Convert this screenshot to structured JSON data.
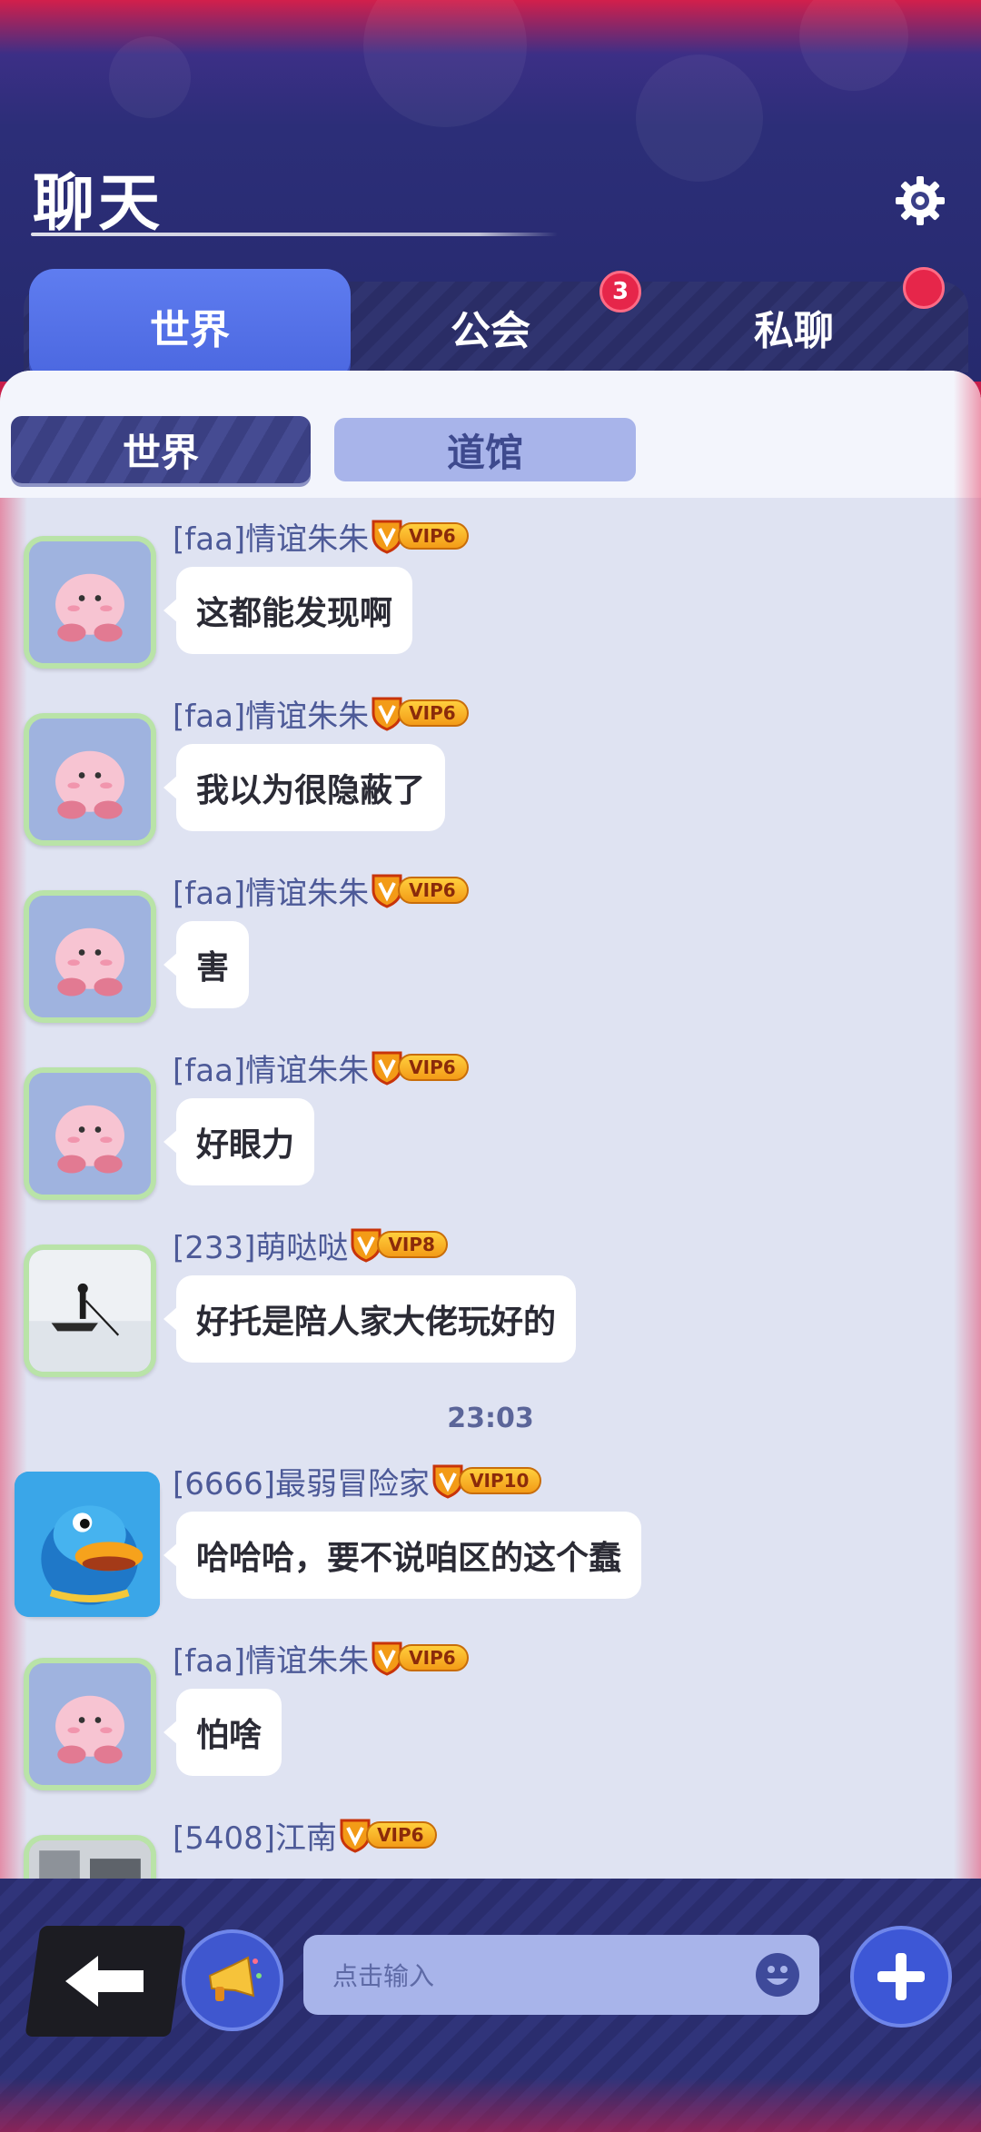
{
  "header": {
    "title": "聊天"
  },
  "tabs": [
    {
      "label": "世界",
      "active": true
    },
    {
      "label": "公会",
      "badge": "3"
    },
    {
      "label": "私聊",
      "dot": true
    }
  ],
  "subtabs": [
    {
      "label": "世界",
      "active": true
    },
    {
      "label": "道馆"
    }
  ],
  "messages": [
    {
      "sender": "[faa]情谊朱朱",
      "vip": "VIP6",
      "text": "这都能发现啊",
      "avatar": "pink-blob-avatar"
    },
    {
      "sender": "[faa]情谊朱朱",
      "vip": "VIP6",
      "text": "我以为很隐蔽了",
      "avatar": "pink-blob-avatar"
    },
    {
      "sender": "[faa]情谊朱朱",
      "vip": "VIP6",
      "text": "害",
      "avatar": "pink-blob-avatar"
    },
    {
      "sender": "[faa]情谊朱朱",
      "vip": "VIP6",
      "text": "好眼力",
      "avatar": "pink-blob-avatar"
    },
    {
      "sender": "[233]萌哒哒",
      "vip": "VIP8",
      "text": "好托是陪人家大佬玩好的",
      "avatar": "boat-avatar"
    },
    {
      "sender": "[6666]最弱冒险家",
      "vip": "VIP10",
      "text": "哈哈哈，要不说咱区的这个蠢",
      "avatar": "duck-avatar"
    },
    {
      "sender": "[faa]情谊朱朱",
      "vip": "VIP6",
      "text": "怕啥",
      "avatar": "pink-blob-avatar"
    },
    {
      "sender": "[5408]江南",
      "vip": "VIP6",
      "text": "",
      "avatar": "photo-avatar"
    }
  ],
  "timestamp": "23:03",
  "input": {
    "placeholder": "点击输入"
  },
  "colors": {
    "accent": "#4a66df",
    "header_bg": "#262a6e",
    "panel_bg": "#dfe3f2",
    "badge_red": "#e6264a",
    "vip_gold": "#f39b17"
  }
}
